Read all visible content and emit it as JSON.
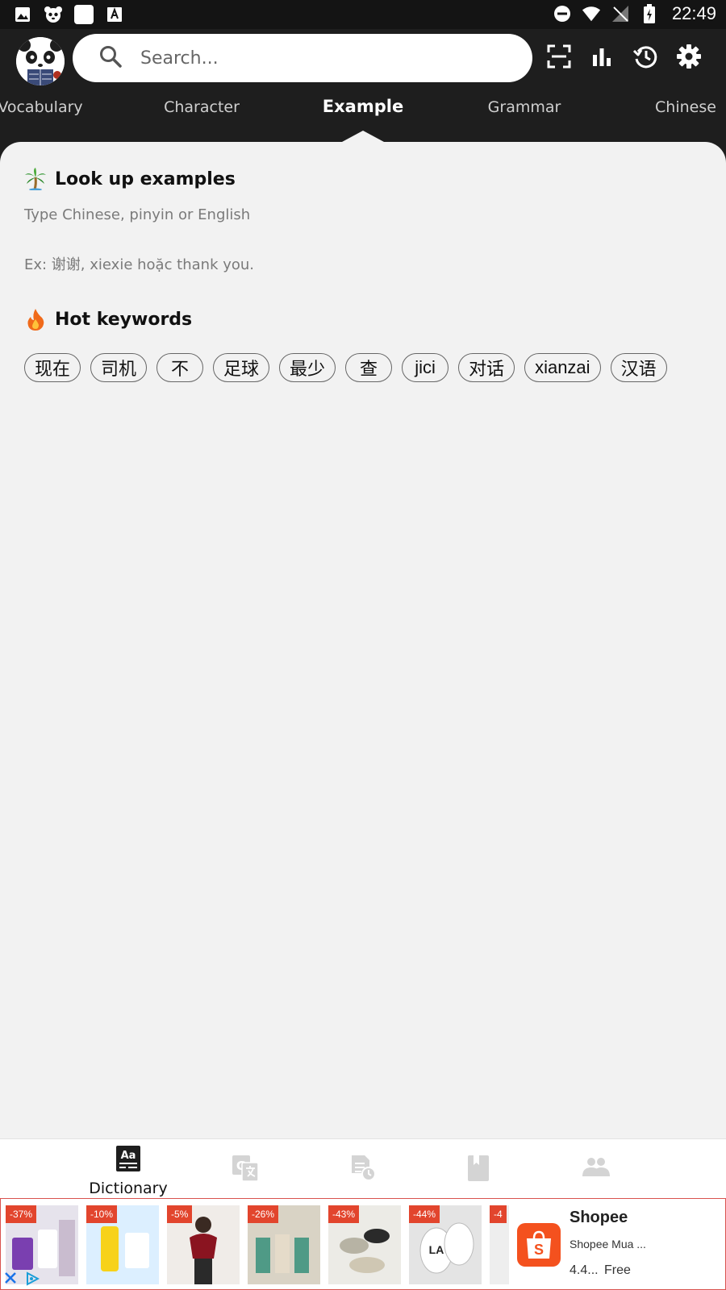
{
  "status_bar": {
    "time": "22:49"
  },
  "search": {
    "placeholder": "Search..."
  },
  "tabs": [
    {
      "label": "Vocabulary"
    },
    {
      "label": "Character"
    },
    {
      "label": "Example"
    },
    {
      "label": "Grammar"
    },
    {
      "label": "Chinese"
    }
  ],
  "active_tab": "Example",
  "lookup": {
    "title": "Look up examples",
    "hint": "Type Chinese, pinyin or English",
    "example": "Ex: 谢谢, xiexie hoặc thank you."
  },
  "hot_keywords": {
    "title": "Hot keywords",
    "items": [
      "现在",
      "司机",
      "不",
      "足球",
      "最少",
      "查",
      "jici",
      "对话",
      "xianzai",
      "汉语"
    ]
  },
  "bottom_nav": {
    "items": [
      {
        "label": "Dictionary",
        "icon": "dictionary-icon",
        "active": true
      },
      {
        "label": "",
        "icon": "translate-icon",
        "active": false
      },
      {
        "label": "",
        "icon": "test-icon",
        "active": false
      },
      {
        "label": "",
        "icon": "notebook-icon",
        "active": false
      },
      {
        "label": "",
        "icon": "community-icon",
        "active": false
      }
    ]
  },
  "ad": {
    "discounts": [
      "-37%",
      "-10%",
      "-5%",
      "-26%",
      "-43%",
      "-44%",
      "-4"
    ],
    "title": "Shopee",
    "subtitle": "Shopee Mua ...",
    "rating": "4.4...",
    "price": "Free"
  },
  "colors": {
    "header_bg": "#1e1e1e",
    "content_bg": "#f2f2f2",
    "ad_badge": "#e2452d",
    "shopee": "#f4511e"
  }
}
